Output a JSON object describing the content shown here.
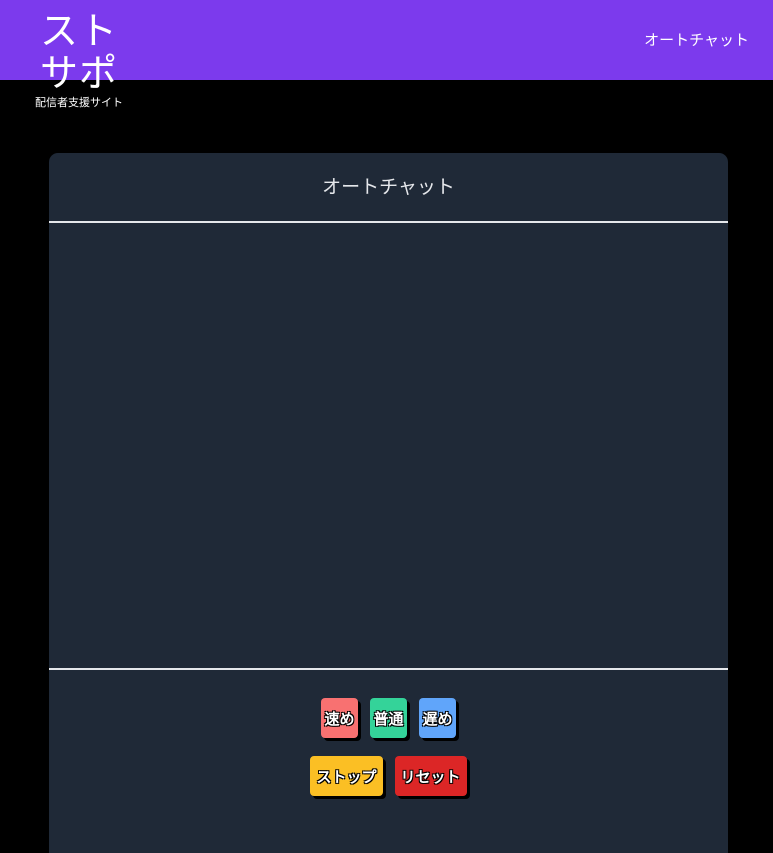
{
  "header": {
    "logo_main": "ストサポ",
    "logo_sub": "配信者支援サイト",
    "nav_label": "オートチャット",
    "bg_color": "#7c3aed"
  },
  "panel": {
    "title": "オートチャット",
    "bg_color": "#1f2937"
  },
  "controls": {
    "speed_buttons": [
      {
        "label": "速め",
        "color": "#f87171"
      },
      {
        "label": "普通",
        "color": "#34d399"
      },
      {
        "label": "遅め",
        "color": "#60a5fa"
      }
    ],
    "action_buttons": [
      {
        "label": "ストップ",
        "color": "#fbbf24"
      },
      {
        "label": "リセット",
        "color": "#dc2626"
      }
    ]
  }
}
